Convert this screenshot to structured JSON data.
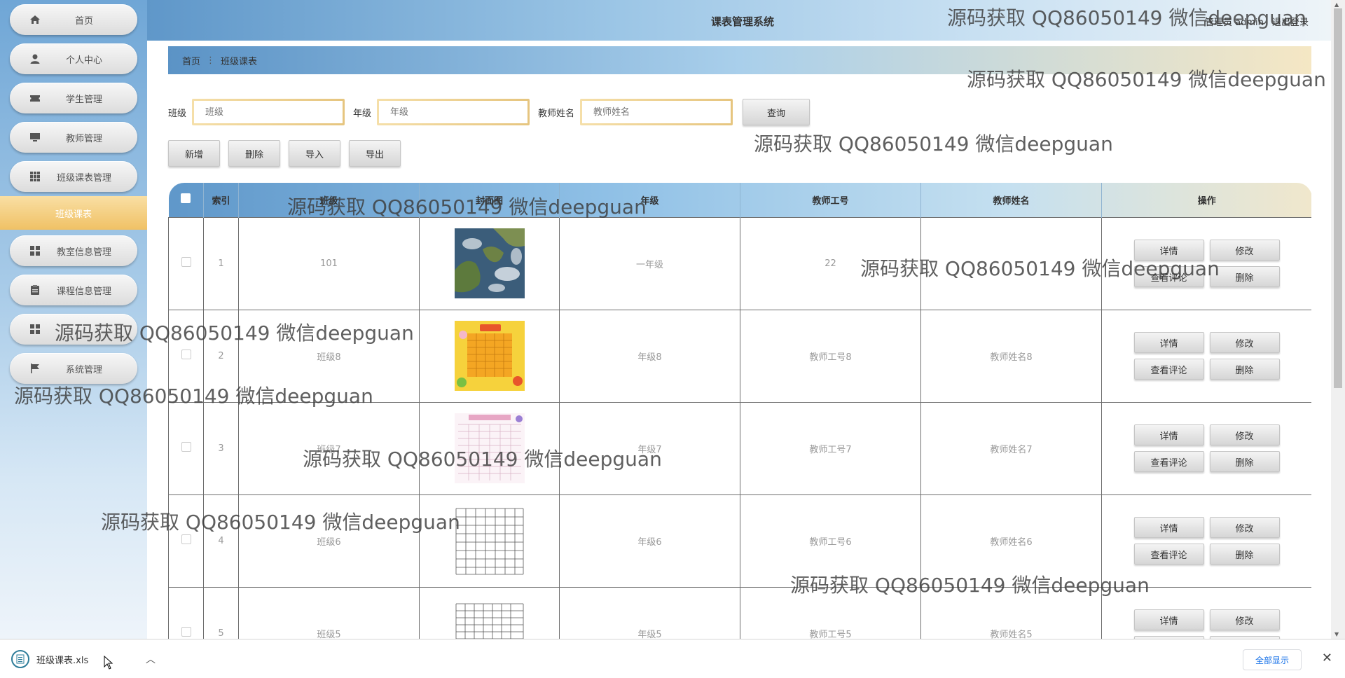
{
  "sidebar": {
    "items": [
      {
        "label": "首页",
        "icon": "home-icon"
      },
      {
        "label": "个人中心",
        "icon": "user-icon"
      },
      {
        "label": "学生管理",
        "icon": "ticket-icon"
      },
      {
        "label": "教师管理",
        "icon": "monitor-icon"
      },
      {
        "label": "班级课表管理",
        "icon": "grid-icon"
      },
      {
        "label": "教室信息管理",
        "icon": "grid-icon"
      },
      {
        "label": "课程信息管理",
        "icon": "clipboard-icon"
      },
      {
        "label": "",
        "icon": "grid-icon"
      },
      {
        "label": "系统管理",
        "icon": "flag-icon"
      }
    ],
    "active_sub": "班级课表"
  },
  "header": {
    "title": "课表管理系统",
    "user": "管理员 admin",
    "logout": "退出登录"
  },
  "breadcrumb": {
    "home": "首页",
    "sep": "⋮",
    "current": "班级课表"
  },
  "search": {
    "class_label": "班级",
    "class_placeholder": "班级",
    "grade_label": "年级",
    "grade_placeholder": "年级",
    "teacher_label": "教师姓名",
    "teacher_placeholder": "教师姓名",
    "query_button": "查询"
  },
  "actions": {
    "add": "新增",
    "delete": "删除",
    "import": "导入",
    "export": "导出"
  },
  "table": {
    "headers": [
      "",
      "索引",
      "班级",
      "封面图",
      "年级",
      "教师工号",
      "教师姓名",
      "操作"
    ],
    "ops": {
      "detail": "详情",
      "edit": "修改",
      "comments": "查看评论",
      "delete": "删除"
    },
    "rows": [
      {
        "index": "1",
        "class": "101",
        "grade": "一年级",
        "teacher_id": "22",
        "teacher_name": "",
        "image": "satellite-map"
      },
      {
        "index": "2",
        "class": "班级8",
        "grade": "年级8",
        "teacher_id": "教师工号8",
        "teacher_name": "教师姓名8",
        "image": "yellow-timetable"
      },
      {
        "index": "3",
        "class": "班级7",
        "grade": "年级7",
        "teacher_id": "教师工号7",
        "teacher_name": "教师姓名7",
        "image": "pink-timetable"
      },
      {
        "index": "4",
        "class": "班级6",
        "grade": "年级6",
        "teacher_id": "教师工号6",
        "teacher_name": "教师姓名6",
        "image": "grid-timetable"
      },
      {
        "index": "5",
        "class": "班级5",
        "grade": "年级5",
        "teacher_id": "教师工号5",
        "teacher_name": "教师姓名5",
        "image": "grid-timetable"
      }
    ]
  },
  "download": {
    "filename": "班级课表.xls",
    "show_all": "全部显示"
  },
  "watermark": "源码获取 QQ86050149 微信deepguan"
}
